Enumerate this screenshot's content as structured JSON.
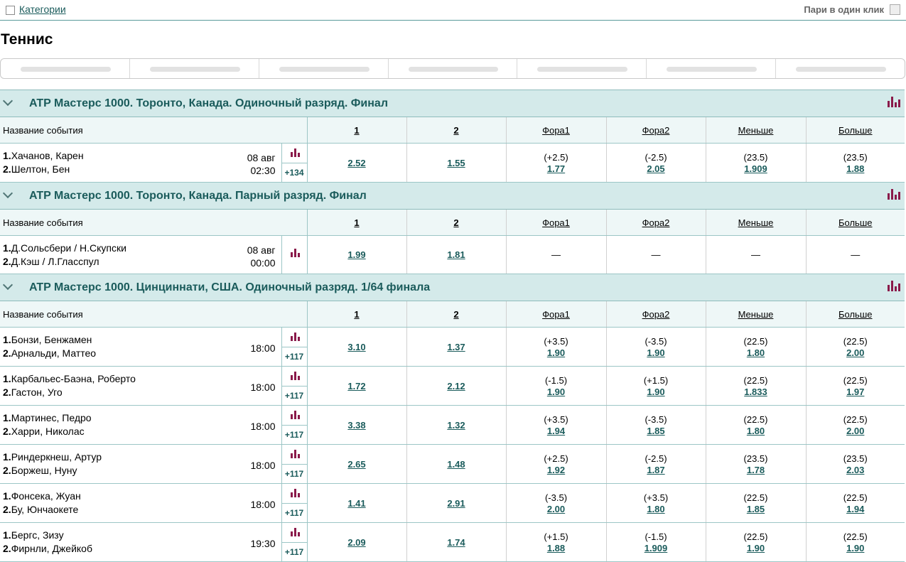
{
  "topbar": {
    "categories_label": "Категории",
    "one_click_label": "Пари в один клик"
  },
  "page_title": "Теннис",
  "tabs_count": 7,
  "columns": {
    "name": "Название события",
    "c1": "1",
    "c2": "2",
    "h1": "Фора1",
    "h2": "Фора2",
    "under": "Меньше",
    "over": "Больше"
  },
  "leagues": [
    {
      "title": "ATP Мастерс 1000. Торонто, Канада. Одиночный разряд. Финал",
      "events": [
        {
          "p1": "Хачанов, Карен",
          "p2": "Шелтон, Бен",
          "date": "08 авг",
          "time": "02:30",
          "more": "+134",
          "w1": "2.52",
          "w2": "1.55",
          "h1p": "(+2.5)",
          "h1": "1.77",
          "h2p": "(-2.5)",
          "h2": "2.05",
          "up": "(23.5)",
          "under": "1.909",
          "op": "(23.5)",
          "over": "1.88"
        }
      ]
    },
    {
      "title": "ATP Мастерс 1000. Торонто, Канада. Парный разряд. Финал",
      "events": [
        {
          "p1": "Д.Сольсбери / Н.Скупски",
          "p2": "Д.Кэш / Л.Гласспул",
          "date": "08 авг",
          "time": "00:00",
          "more": "",
          "w1": "1.99",
          "w2": "1.81",
          "h1p": "",
          "h1": "—",
          "h2p": "",
          "h2": "—",
          "up": "",
          "under": "—",
          "op": "",
          "over": "—"
        }
      ]
    },
    {
      "title": "ATP Мастерс 1000. Цинциннати, США. Одиночный разряд. 1/64 финала",
      "events": [
        {
          "p1": "Бонзи, Бенжамен",
          "p2": "Арнальди, Маттео",
          "date": "",
          "time": "18:00",
          "more": "+117",
          "w1": "3.10",
          "w2": "1.37",
          "h1p": "(+3.5)",
          "h1": "1.90",
          "h2p": "(-3.5)",
          "h2": "1.90",
          "up": "(22.5)",
          "under": "1.80",
          "op": "(22.5)",
          "over": "2.00"
        },
        {
          "p1": "Карбальес-Баэна, Роберто",
          "p2": "Гастон, Уго",
          "date": "",
          "time": "18:00",
          "more": "+117",
          "w1": "1.72",
          "w2": "2.12",
          "h1p": "(-1.5)",
          "h1": "1.90",
          "h2p": "(+1.5)",
          "h2": "1.90",
          "up": "(22.5)",
          "under": "1.833",
          "op": "(22.5)",
          "over": "1.97"
        },
        {
          "p1": "Мартинес, Педро",
          "p2": "Харри, Николас",
          "date": "",
          "time": "18:00",
          "more": "+117",
          "w1": "3.38",
          "w2": "1.32",
          "h1p": "(+3.5)",
          "h1": "1.94",
          "h2p": "(-3.5)",
          "h2": "1.85",
          "up": "(22.5)",
          "under": "1.80",
          "op": "(22.5)",
          "over": "2.00"
        },
        {
          "p1": "Риндеркнеш, Артур",
          "p2": "Боржеш, Нуну",
          "date": "",
          "time": "18:00",
          "more": "+117",
          "w1": "2.65",
          "w2": "1.48",
          "h1p": "(+2.5)",
          "h1": "1.92",
          "h2p": "(-2.5)",
          "h2": "1.87",
          "up": "(23.5)",
          "under": "1.78",
          "op": "(23.5)",
          "over": "2.03"
        },
        {
          "p1": "Фонсека, Жуан",
          "p2": "Бу, Юнчаокете",
          "date": "",
          "time": "18:00",
          "more": "+117",
          "w1": "1.41",
          "w2": "2.91",
          "h1p": "(-3.5)",
          "h1": "2.00",
          "h2p": "(+3.5)",
          "h2": "1.80",
          "up": "(22.5)",
          "under": "1.85",
          "op": "(22.5)",
          "over": "1.94"
        },
        {
          "p1": "Бергс, Зизу",
          "p2": "Фирнли, Джейкоб",
          "date": "",
          "time": "19:30",
          "more": "+117",
          "w1": "2.09",
          "w2": "1.74",
          "h1p": "(+1.5)",
          "h1": "1.88",
          "h2p": "(-1.5)",
          "h2": "1.909",
          "up": "(22.5)",
          "under": "1.90",
          "op": "(22.5)",
          "over": "1.90"
        }
      ]
    }
  ],
  "colors": {
    "accent": "#1a5b5b",
    "league_bg": "#d4eaea",
    "header_bg": "#eef7f7",
    "stats_icon": "#8a1a4a"
  }
}
